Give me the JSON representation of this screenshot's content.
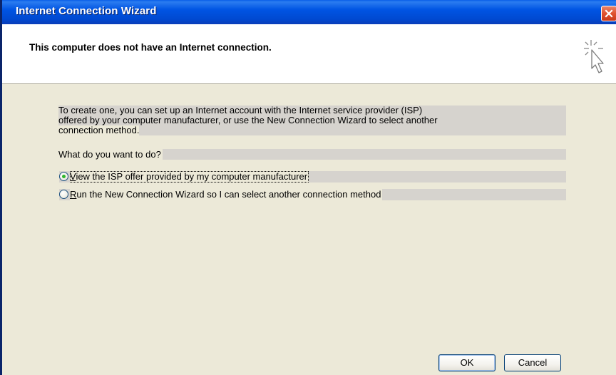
{
  "window": {
    "title": "Internet Connection Wizard"
  },
  "header": {
    "heading": "This computer does not have an Internet connection.",
    "icon": "wizard-cursor-icon"
  },
  "content": {
    "description_lines": [
      "To create one, you can set up an Internet account with the Internet service provider (ISP)",
      "offered by your computer manufacturer, or use the New Connection Wizard to select another",
      "connection method."
    ],
    "prompt": "What do you want to do?",
    "options": [
      {
        "label_first": "V",
        "label_rest": "iew the ISP offer provided by my computer manufacturer",
        "checked": true
      },
      {
        "label_first": "R",
        "label_rest": "un the New Connection Wizard so I can select another connection method",
        "checked": false
      }
    ]
  },
  "buttons": {
    "ok": "OK",
    "cancel": "Cancel"
  },
  "colors": {
    "titlebar": "#0054e3",
    "dialog_bg": "#ece9d8",
    "close": "#e0512e",
    "radio_dot": "#2eb52e"
  }
}
